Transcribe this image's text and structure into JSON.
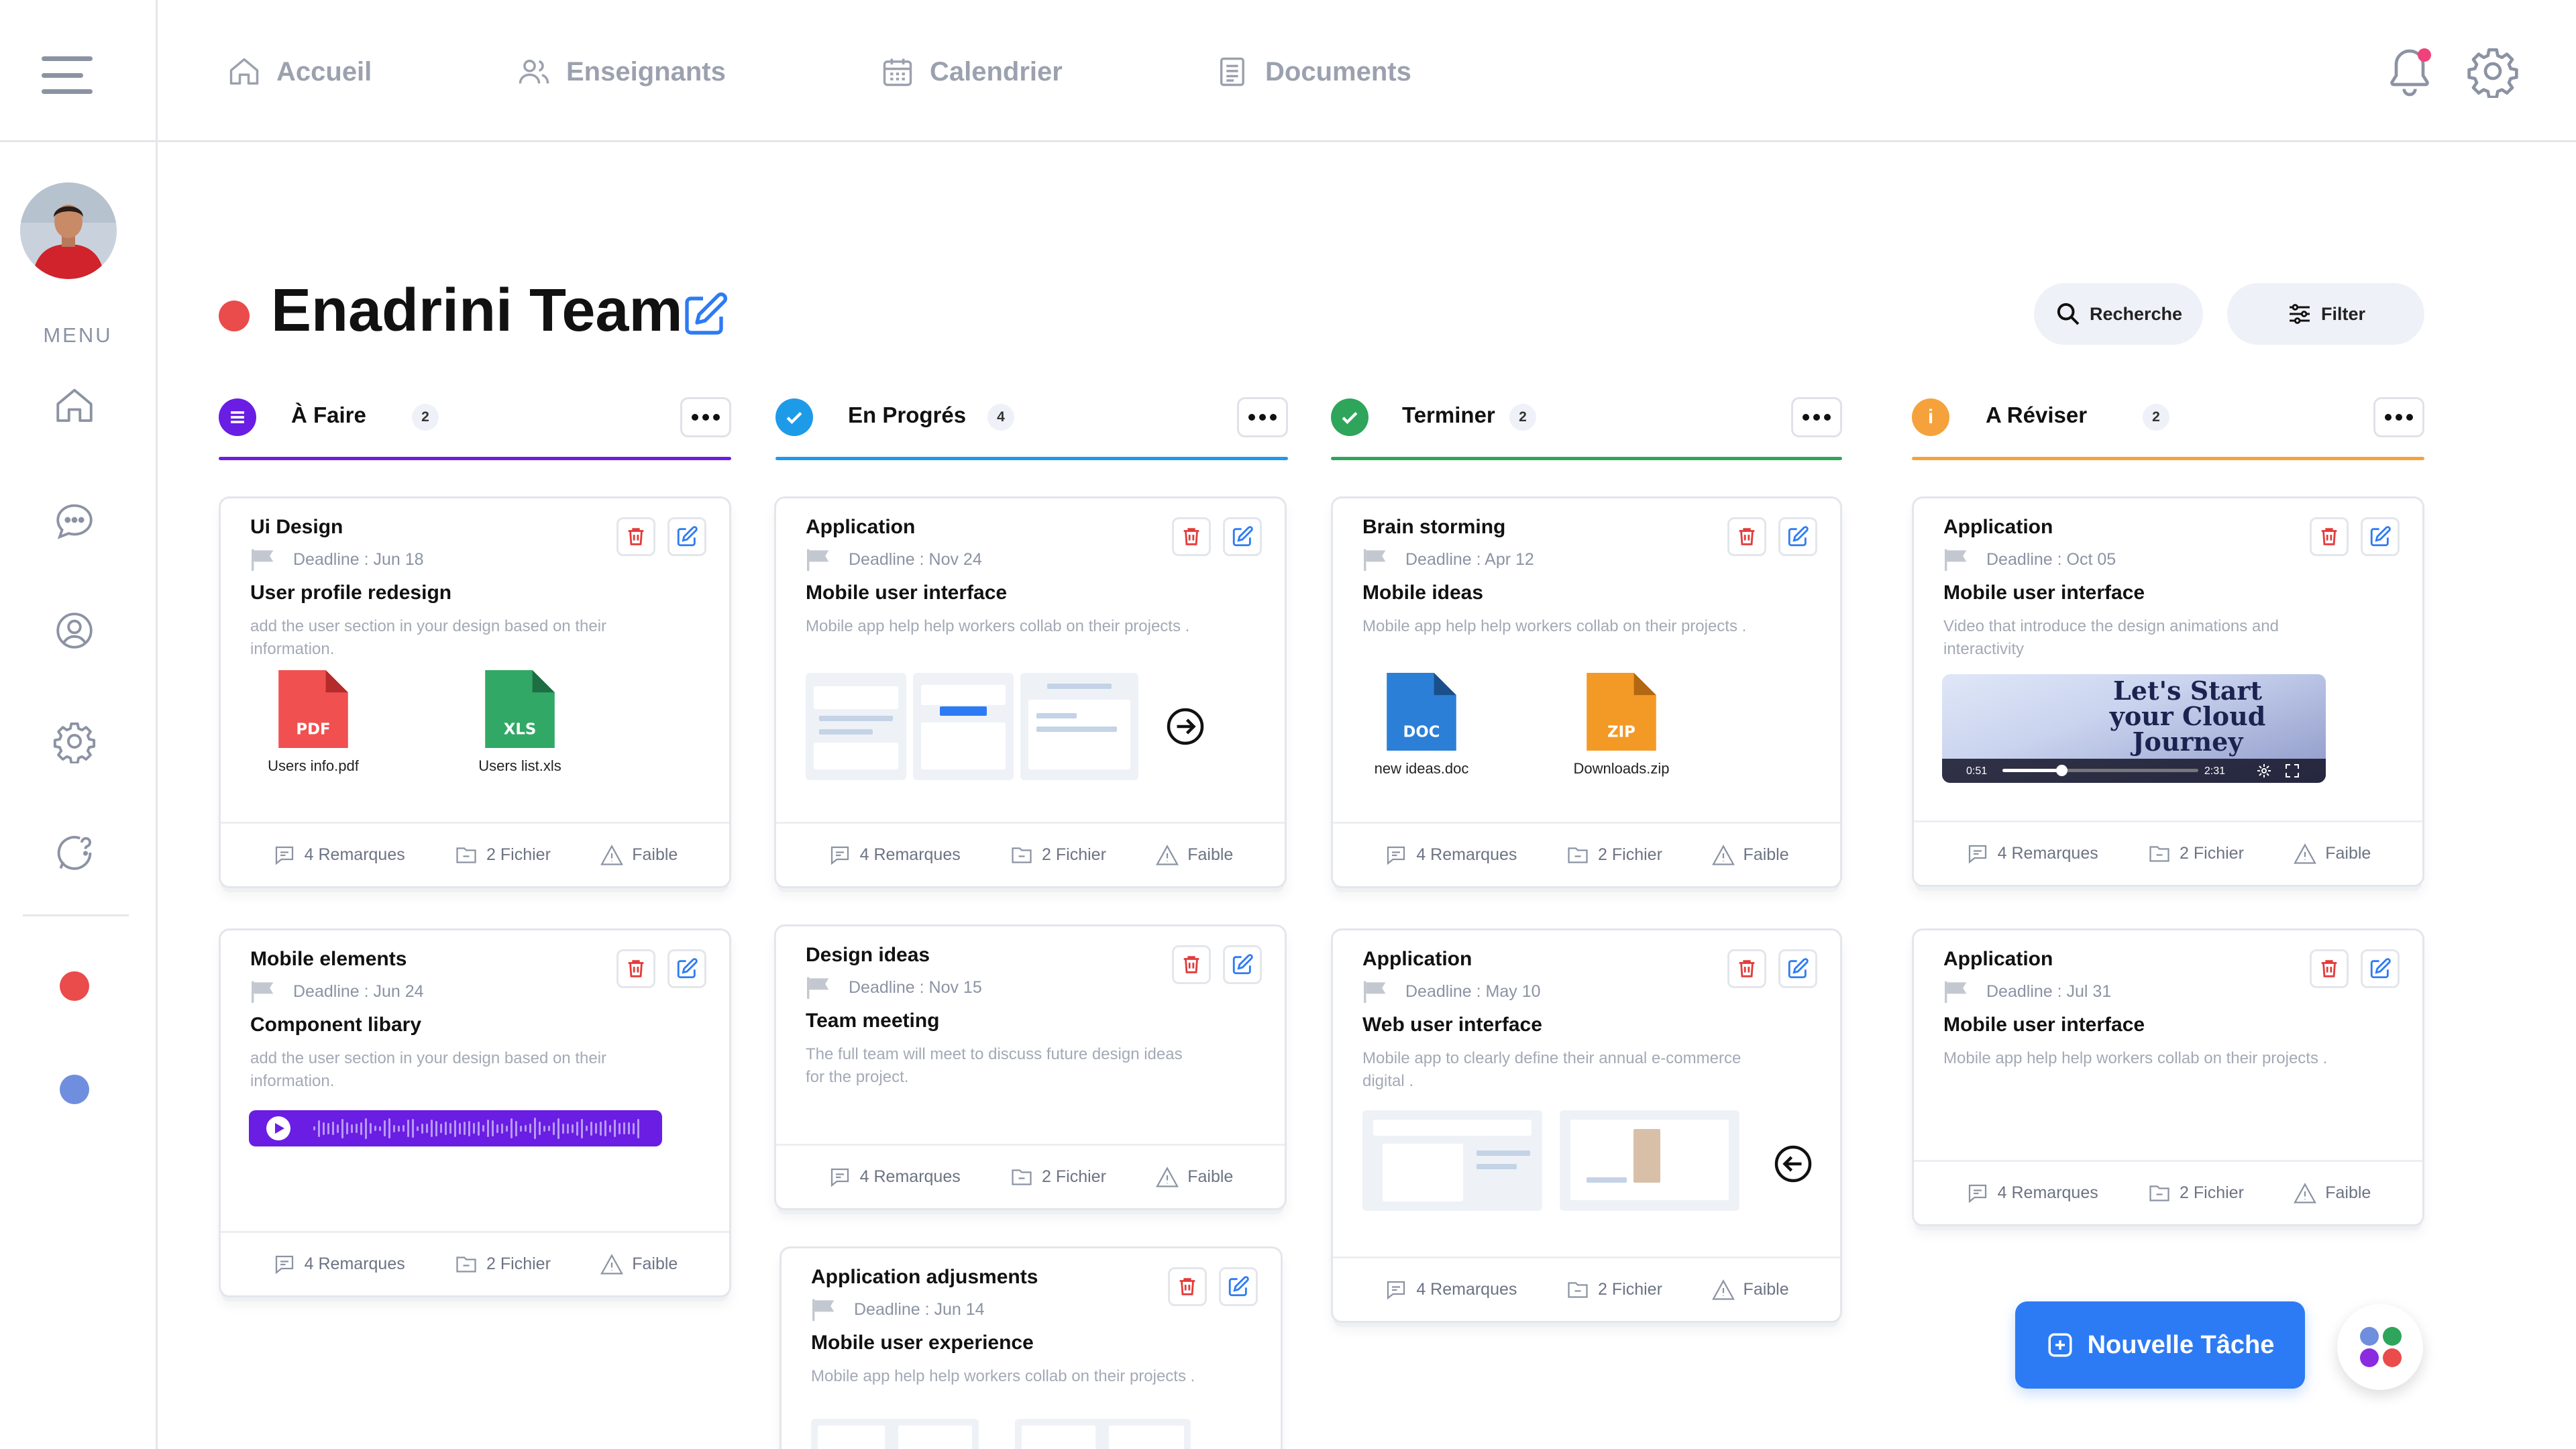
{
  "nav": {
    "items": [
      {
        "label": "Accueil",
        "icon": "home-icon"
      },
      {
        "label": "Enseignants",
        "icon": "users-icon"
      },
      {
        "label": "Calendrier",
        "icon": "calendar-icon"
      },
      {
        "label": "Documents",
        "icon": "document-icon"
      }
    ]
  },
  "sidebar": {
    "menu_label": "MENU",
    "icons": [
      "home-icon",
      "chat-icon",
      "user-circle-icon",
      "gear-icon",
      "help-chat-icon"
    ],
    "dots": [
      "#ea4b4b",
      "#6f8fde"
    ]
  },
  "header": {
    "title": "Enadrini Team",
    "search_label": "Recherche",
    "filter_label": "Filter"
  },
  "columns": [
    {
      "title": "À Faire",
      "count": "2",
      "color": "#6a1de3"
    },
    {
      "title": "En Progrés",
      "count": "4",
      "color": "#1e9be8"
    },
    {
      "title": "Terminer",
      "count": "2",
      "color": "#2ea55b"
    },
    {
      "title": "A Réviser",
      "count": "2",
      "color": "#f5a23c"
    }
  ],
  "cards": {
    "todo": [
      {
        "category": "Ui Design",
        "deadline": "Deadline : Jun 18",
        "title": "User profile redesign",
        "desc": "add the user section in your design based on their information.",
        "files": [
          {
            "type": "PDF",
            "name": "Users info.pdf"
          },
          {
            "type": "XLS",
            "name": "Users list.xls"
          }
        ],
        "remarks": "4 Remarques",
        "files_count": "2 Fichier",
        "priority": "Faible"
      },
      {
        "category": "Mobile elements",
        "deadline": "Deadline : Jun 24",
        "title": "Component libary",
        "desc": "add the user section in your design based on their information.",
        "remarks": "4 Remarques",
        "files_count": "2 Fichier",
        "priority": "Faible"
      }
    ],
    "progress": [
      {
        "category": "Application",
        "deadline": "Deadline : Nov 24",
        "title": "Mobile user interface",
        "desc": "Mobile app help help workers collab on their projects .",
        "remarks": "4 Remarques",
        "files_count": "2 Fichier",
        "priority": "Faible"
      },
      {
        "category": "Design ideas",
        "deadline": "Deadline : Nov 15",
        "title": "Team meeting",
        "desc": "The full team will meet to discuss future design ideas for the project.",
        "remarks": "4 Remarques",
        "files_count": "2 Fichier",
        "priority": "Faible"
      },
      {
        "category": "Application adjusments",
        "deadline": "Deadline : Jun 14",
        "title": "Mobile user experience",
        "desc": "Mobile app help help workers collab on their projects ."
      }
    ],
    "done": [
      {
        "category": "Brain storming",
        "deadline": "Deadline : Apr 12",
        "title": "Mobile ideas",
        "desc": "Mobile app help help workers collab on their projects .",
        "files": [
          {
            "type": "DOC",
            "name": "new ideas.doc"
          },
          {
            "type": "ZIP",
            "name": "Downloads.zip"
          }
        ],
        "remarks": "4 Remarques",
        "files_count": "2 Fichier",
        "priority": "Faible"
      },
      {
        "category": "Application",
        "deadline": "Deadline : May 10",
        "title": "Web user interface",
        "desc": "Mobile app to clearly define their annual e-commerce digital .",
        "remarks": "4 Remarques",
        "files_count": "2 Fichier",
        "priority": "Faible"
      }
    ],
    "review": [
      {
        "category": "Application",
        "deadline": "Deadline : Oct 05",
        "title": "Mobile user interface",
        "desc": "Video that introduce the design animations and interactivity",
        "video": {
          "title": "Let's Start your Cloud Journey",
          "current": "0:51",
          "duration": "2:31",
          "progress": 0.3
        },
        "remarks": "4 Remarques",
        "files_count": "2 Fichier",
        "priority": "Faible"
      },
      {
        "category": "Application",
        "deadline": "Deadline : Jul 31",
        "title": "Mobile user interface",
        "desc": "Mobile app help help workers collab on their projects .",
        "remarks": "4 Remarques",
        "files_count": "2 Fichier",
        "priority": "Faible"
      }
    ]
  },
  "fab": {
    "label": "Nouvelle Tâche"
  }
}
